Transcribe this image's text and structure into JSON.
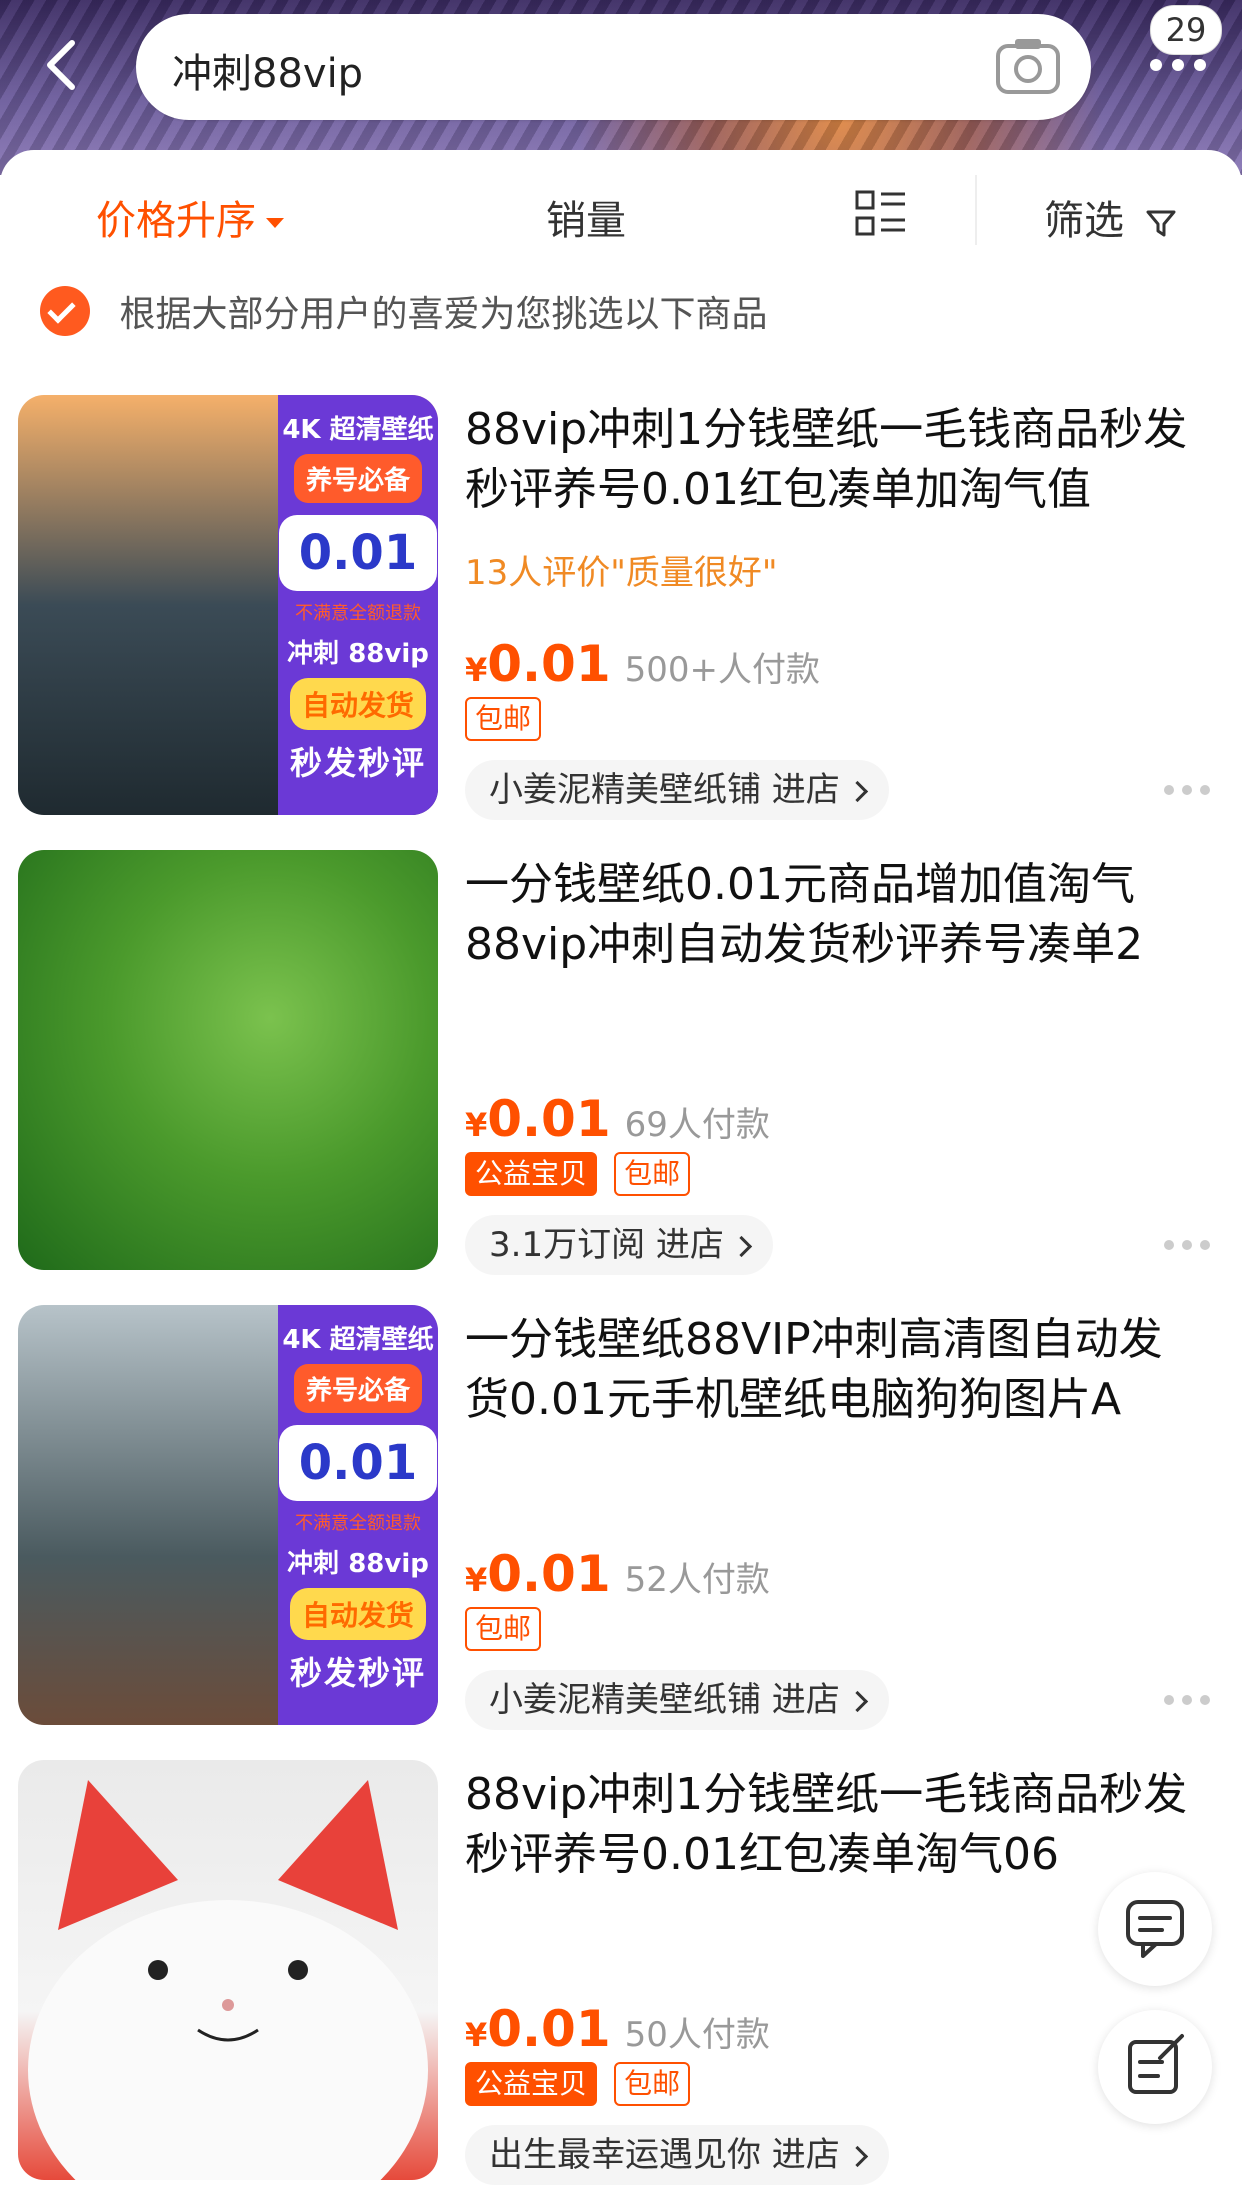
{
  "header": {
    "search_query": "冲刺88vip",
    "badge_count": "29"
  },
  "sortbar": {
    "price_label": "价格升序",
    "sales_label": "销量",
    "filter_label": "筛选"
  },
  "hint": "根据大部分用户的喜爱为您挑选以下商品",
  "products": [
    {
      "title": "88vip冲刺1分钱壁纸一毛钱商品秒发秒评养号0.01红包凑单加淘气值",
      "praise": "13人评价\"质量很好\"",
      "yen": "¥",
      "price": "0.01",
      "sales": "500+人付款",
      "tags": [
        "包邮"
      ],
      "shop": "小姜泥精美壁纸铺 进店",
      "banner": {
        "line1": "4K 超清壁纸",
        "line2": "养号必备",
        "price": "0.01",
        "small": "不满意全额退款",
        "line3": "冲刺 88vip",
        "line4": "自动发货",
        "line5": "秒发秒评"
      }
    },
    {
      "title": "一分钱壁纸0.01元商品增加值淘气88vip冲刺自动发货秒评养号凑单2",
      "yen": "¥",
      "price": "0.01",
      "sales": "69人付款",
      "tags": [
        "公益宝贝",
        "包邮"
      ],
      "shop": "3.1万订阅 进店"
    },
    {
      "title": "一分钱壁纸88VIP冲刺高清图自动发货0.01元手机壁纸电脑狗狗图片A",
      "yen": "¥",
      "price": "0.01",
      "sales": "52人付款",
      "tags": [
        "包邮"
      ],
      "shop": "小姜泥精美壁纸铺 进店",
      "banner": {
        "line1": "4K 超清壁纸",
        "line2": "养号必备",
        "price": "0.01",
        "small": "不满意全额退款",
        "line3": "冲刺 88vip",
        "line4": "自动发货",
        "line5": "秒发秒评"
      }
    },
    {
      "title": "88vip冲刺1分钱壁纸一毛钱商品秒发秒评养号0.01红包凑单淘气06",
      "yen": "¥",
      "price": "0.01",
      "sales": "50人付款",
      "tags": [
        "公益宝贝",
        "包邮"
      ],
      "shop": "出生最幸运遇见你 进店"
    }
  ]
}
